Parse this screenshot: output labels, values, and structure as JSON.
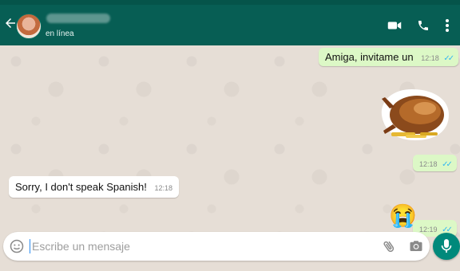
{
  "header": {
    "status": "en línea"
  },
  "messages": [
    {
      "text": "Amiga, invitame un",
      "time": "12:18",
      "ticks": "✓✓"
    },
    {
      "time": "12:18",
      "ticks": "✓✓"
    },
    {
      "text": "Sorry, I don't speak Spanish!",
      "time": "12:18"
    },
    {
      "emoji": "😭",
      "time": "12:19",
      "ticks": "✓✓"
    }
  ],
  "composer": {
    "placeholder": "Escribe un mensaje"
  },
  "colors": {
    "header": "#075e54",
    "outgoing_bubble": "#dcf8c6",
    "incoming_bubble": "#ffffff",
    "mic_button": "#00897b",
    "read_ticks": "#34b7f1"
  }
}
